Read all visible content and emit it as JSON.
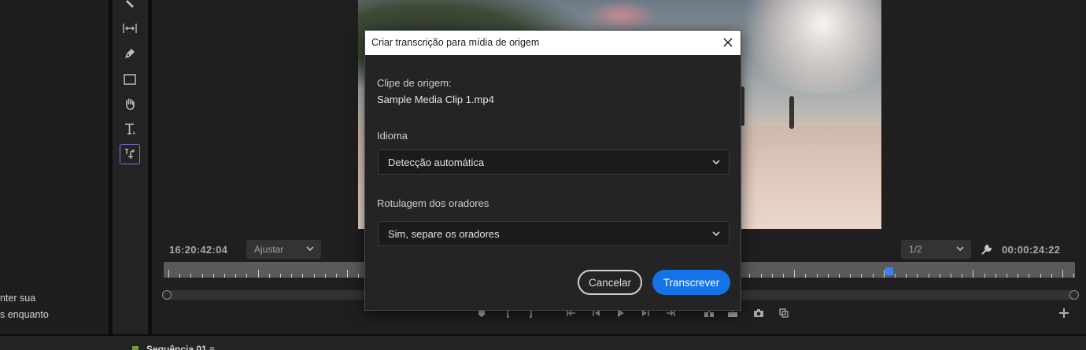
{
  "left_panel": {
    "text_line_1": "nter sua",
    "text_line_2": "s enquanto"
  },
  "tools": [
    {
      "icon": "ripple-edit-icon"
    },
    {
      "icon": "slip-icon"
    },
    {
      "icon": "pen-icon"
    },
    {
      "icon": "rectangle-icon"
    },
    {
      "icon": "hand-icon"
    },
    {
      "icon": "type-icon"
    },
    {
      "icon": "transcript-caption-icon",
      "active": true
    }
  ],
  "monitor": {
    "timecode_left": "16:20:42:04",
    "fit_select": "Ajustar",
    "resolution_select": "1/2",
    "timecode_right": "00:00:24:22"
  },
  "bottom_panel": {
    "title": "Sequência 01 ≡"
  },
  "dialog": {
    "title": "Criar transcrição para mídia de origem",
    "source_label": "Clipe de origem:",
    "source_value": "Sample Media Clip 1.mp4",
    "language_label": "Idioma",
    "language_value": "Detecção automática",
    "speaker_label": "Rotulagem dos oradores",
    "speaker_value": "Sim, separe os oradores",
    "cancel_label": "Cancelar",
    "transcribe_label": "Transcrever"
  },
  "colors": {
    "accent": "#1473e6",
    "active_tool": "#8b6fdc",
    "playhead": "#3c82f0"
  }
}
